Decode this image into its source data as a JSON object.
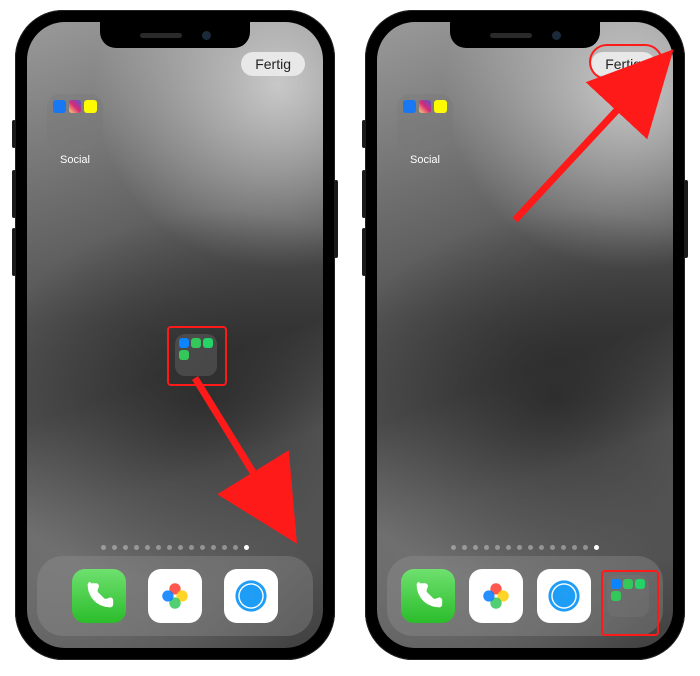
{
  "phones": {
    "left": {
      "done_label": "Fertig",
      "folder_top": {
        "label": "Social",
        "apps": [
          "facebook",
          "instagram",
          "snapchat"
        ]
      },
      "folder_mid": {
        "label": "",
        "apps": [
          "messages",
          "facetime",
          "whatsapp",
          "messages2"
        ]
      },
      "page_dots": {
        "count": 14,
        "active_index": 13
      },
      "dock": [
        "phone",
        "photos",
        "safari"
      ]
    },
    "right": {
      "done_label": "Fertig",
      "folder_top": {
        "label": "Social",
        "apps": [
          "facebook",
          "instagram",
          "snapchat"
        ]
      },
      "page_dots": {
        "count": 14,
        "active_index": 13
      },
      "dock": [
        "phone",
        "photos",
        "safari",
        "folder"
      ],
      "dock_folder": {
        "apps": [
          "messages",
          "facetime",
          "whatsapp",
          "messages2"
        ]
      }
    }
  },
  "annotations": {
    "left_highlight": "folder-being-dragged",
    "right_highlight": "dock-folder-slot",
    "right_highlight_2": "done-button"
  },
  "colors": {
    "annotation_red": "#ff1a1a",
    "done_pill_bg": "#ebebeb"
  }
}
